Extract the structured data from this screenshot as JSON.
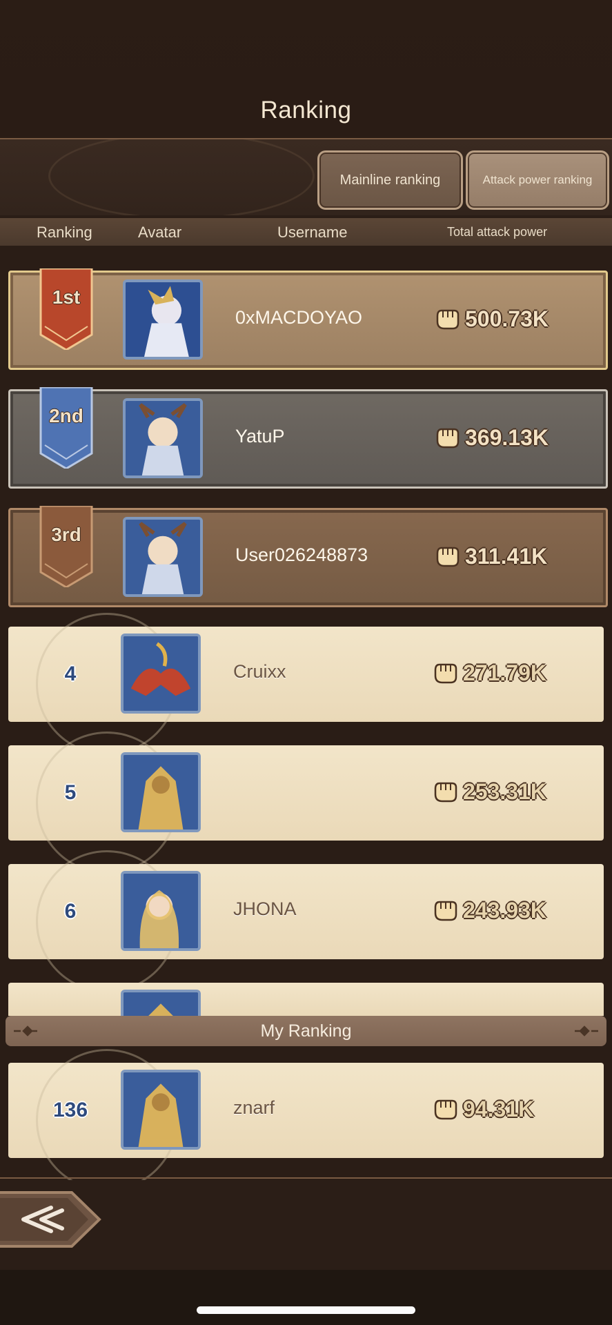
{
  "header": {
    "title": "Ranking"
  },
  "tabs": {
    "mainline": "Mainline ranking",
    "attack_power": "Attack power ranking"
  },
  "columns": {
    "ranking": "Ranking",
    "avatar": "Avatar",
    "username": "Username",
    "power": "Total attack power"
  },
  "rows": [
    {
      "rank": "1st",
      "username": "0xMACDOYAO",
      "power": "500.73K"
    },
    {
      "rank": "2nd",
      "username": "YatuP",
      "power": "369.13K"
    },
    {
      "rank": "3rd",
      "username": "User026248873",
      "power": "311.41K"
    },
    {
      "rank": "4",
      "username": "Cruixx",
      "power": "271.79K"
    },
    {
      "rank": "5",
      "username": "",
      "power": "253.31K"
    },
    {
      "rank": "6",
      "username": "JHONA",
      "power": "243.93K"
    }
  ],
  "my_ranking": {
    "label": "My Ranking",
    "rank": "136",
    "username": "znarf",
    "power": "94.31K"
  },
  "colors": {
    "background": "#2a1d16",
    "gold_row": "#b09270",
    "silver_row": "#6f6962",
    "bronze_row": "#87684e",
    "plain_row": "#f2e5c9",
    "banner_first": "#b8472b",
    "banner_second": "#4f73b3",
    "banner_third": "#8b5a3c",
    "rank_number": "#2e4a7d"
  }
}
